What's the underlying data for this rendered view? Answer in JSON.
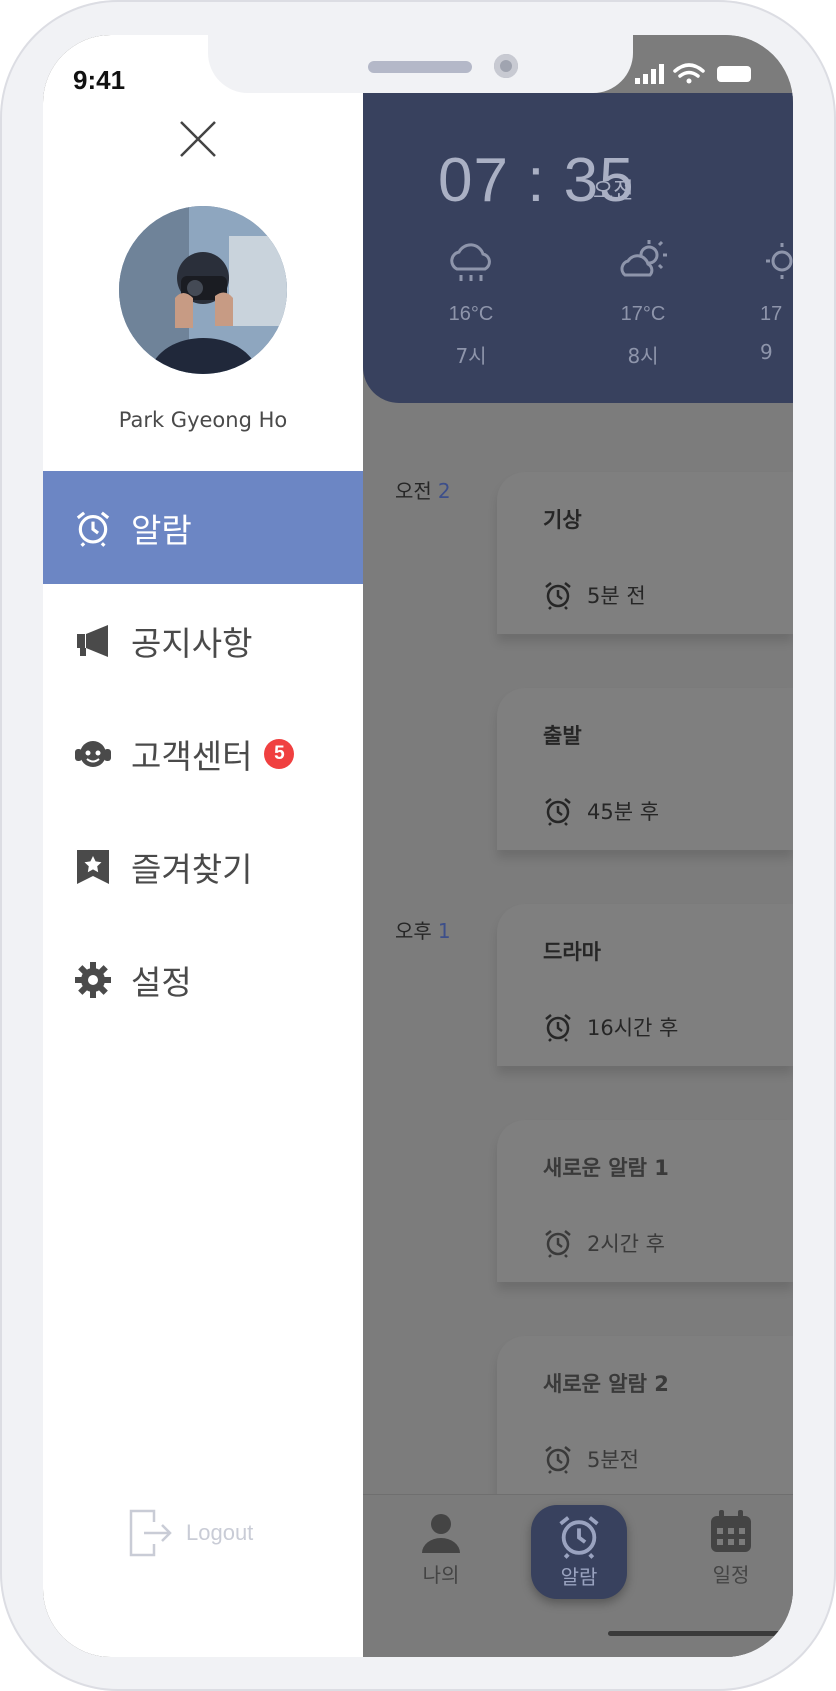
{
  "status_bar": {
    "time": "9:41"
  },
  "header": {
    "time": "07 : 35",
    "ampm": "오전",
    "forecast": [
      {
        "icon": "cloud-rain-icon",
        "temp": "16°C",
        "hour": "7시"
      },
      {
        "icon": "cloud-sun-icon",
        "temp": "17°C",
        "hour": "8시"
      },
      {
        "icon": "sun-icon",
        "temp": "17",
        "hour": "9"
      }
    ]
  },
  "alarm_groups": [
    {
      "label": "오전",
      "count": "2"
    },
    {
      "label": "오후",
      "count": "1"
    }
  ],
  "alarms": [
    {
      "title": "기상",
      "time": "5분 전"
    },
    {
      "title": "출발",
      "time": "45분 후"
    },
    {
      "title": "드라마",
      "time": "16시간 후"
    },
    {
      "title": "새로운 알람 1",
      "time": "2시간 후"
    },
    {
      "title": "새로운 알람 2",
      "time": "5분전"
    }
  ],
  "tabbar": {
    "items": [
      {
        "label": "나의",
        "icon": "person-icon"
      },
      {
        "label": "알람",
        "icon": "alarm-clock-icon",
        "active": true
      },
      {
        "label": "일정",
        "icon": "calendar-icon"
      }
    ]
  },
  "drawer": {
    "user_name": "Park Gyeong Ho",
    "menu": [
      {
        "label": "알람",
        "icon": "alarm-clock-icon",
        "active": true
      },
      {
        "label": "공지사항",
        "icon": "megaphone-icon"
      },
      {
        "label": "고객센터",
        "icon": "headset-icon",
        "badge": "5"
      },
      {
        "label": "즐겨찾기",
        "icon": "bookmark-star-icon"
      },
      {
        "label": "설정",
        "icon": "gear-icon"
      }
    ],
    "logout": "Logout"
  },
  "colors": {
    "accent": "#6c86c4",
    "header_bg": "#38415e",
    "badge": "#f04040",
    "overlay": "#7c7c7c"
  }
}
